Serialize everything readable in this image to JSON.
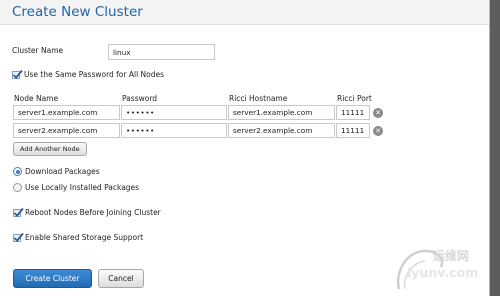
{
  "dialog": {
    "title": "Create New Cluster"
  },
  "cluster_name": {
    "label": "Cluster Name",
    "value": "linux"
  },
  "same_password": {
    "label": "Use the Same Password for All Nodes",
    "checked": true
  },
  "nodes_table": {
    "headers": [
      "Node Name",
      "Password",
      "Ricci Hostname",
      "Ricci Port"
    ],
    "rows": [
      {
        "node_name": "server1.example.com",
        "password": "••••••",
        "ricci_hostname": "server1.example.com",
        "ricci_port": "11111"
      },
      {
        "node_name": "server2.example.com",
        "password": "••••••",
        "ricci_hostname": "server2.example.com",
        "ricci_port": "11111"
      }
    ]
  },
  "add_node_button": "Add Another Node",
  "packages": {
    "options": [
      "Download Packages",
      "Use Locally Installed Packages"
    ],
    "selected": "Download Packages"
  },
  "reboot_nodes": {
    "label": "Reboot Nodes Before Joining Cluster",
    "checked": true
  },
  "shared_storage": {
    "label": "Enable Shared Storage Support",
    "checked": true
  },
  "actions": {
    "create": "Create Cluster",
    "cancel": "Cancel"
  },
  "watermark": {
    "cn": "运维网",
    "url": "iyunv.com"
  },
  "icons": {
    "remove_row": "close-circle-icon",
    "check": "checkmark-icon"
  },
  "colors": {
    "accent": "#1d65a8",
    "primary_button": "#2a76c0"
  }
}
